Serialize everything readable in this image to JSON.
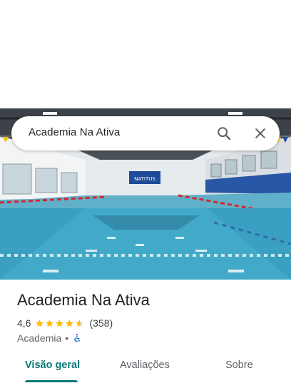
{
  "search": {
    "query": "Academia Na Ativa",
    "search_icon": "search-icon",
    "close_icon": "close-icon"
  },
  "photo": {
    "banner_text": "NATITUS"
  },
  "place": {
    "name": "Academia Na Ativa",
    "rating": "4,6",
    "rating_stars": 4.6,
    "review_count": "(358)",
    "category": "Academia",
    "separator": "•",
    "accessibility_icon": "wheelchair-icon"
  },
  "tabs": [
    {
      "label": "Visão geral",
      "active": true
    },
    {
      "label": "Avaliações",
      "active": false
    },
    {
      "label": "Sobre",
      "active": false
    }
  ],
  "colors": {
    "accent": "#0b7a77",
    "star": "#fbbc04",
    "access_icon": "#1a73e8"
  }
}
